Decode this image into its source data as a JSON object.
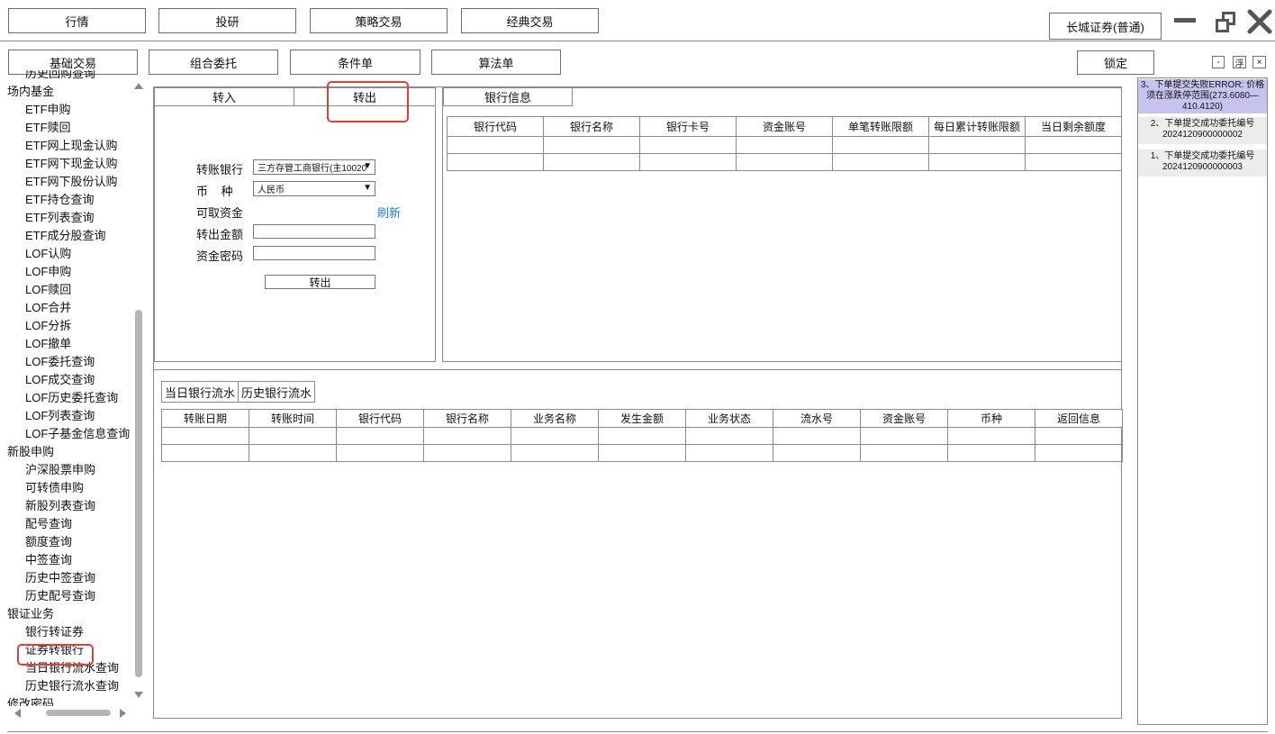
{
  "top_tabs": [
    "行情",
    "投研",
    "策略交易",
    "经典交易"
  ],
  "broker": "长城证券(普通)",
  "sub_tabs": [
    "基础交易",
    "组合委托",
    "条件单",
    "算法单"
  ],
  "lock_label": "锁定",
  "float_label": "浮",
  "close_label": "×",
  "minimize_label": "-",
  "tree": [
    {
      "t": "item",
      "label": "历史回购查询"
    },
    {
      "t": "grp",
      "label": "场内基金"
    },
    {
      "t": "item",
      "label": "ETF申购"
    },
    {
      "t": "item",
      "label": "ETF赎回"
    },
    {
      "t": "item",
      "label": "ETF网上现金认购"
    },
    {
      "t": "item",
      "label": "ETF网下现金认购"
    },
    {
      "t": "item",
      "label": "ETF网下股份认购"
    },
    {
      "t": "item",
      "label": "ETF持仓查询"
    },
    {
      "t": "item",
      "label": "ETF列表查询"
    },
    {
      "t": "item",
      "label": "ETF成分股查询"
    },
    {
      "t": "item",
      "label": "LOF认购"
    },
    {
      "t": "item",
      "label": "LOF申购"
    },
    {
      "t": "item",
      "label": "LOF赎回"
    },
    {
      "t": "item",
      "label": "LOF合并"
    },
    {
      "t": "item",
      "label": "LOF分拆"
    },
    {
      "t": "item",
      "label": "LOF撤单"
    },
    {
      "t": "item",
      "label": "LOF委托查询"
    },
    {
      "t": "item",
      "label": "LOF成交查询"
    },
    {
      "t": "item",
      "label": "LOF历史委托查询"
    },
    {
      "t": "item",
      "label": "LOF列表查询"
    },
    {
      "t": "item",
      "label": "LOF子基金信息查询"
    },
    {
      "t": "grp",
      "label": "新股申购"
    },
    {
      "t": "item",
      "label": "沪深股票申购"
    },
    {
      "t": "item",
      "label": "可转债申购"
    },
    {
      "t": "item",
      "label": "新股列表查询"
    },
    {
      "t": "item",
      "label": "配号查询"
    },
    {
      "t": "item",
      "label": "额度查询"
    },
    {
      "t": "item",
      "label": "中签查询"
    },
    {
      "t": "item",
      "label": "历史中签查询"
    },
    {
      "t": "item",
      "label": "历史配号查询"
    },
    {
      "t": "grp",
      "label": "银证业务"
    },
    {
      "t": "item",
      "label": "银行转证券"
    },
    {
      "t": "item",
      "label": "证券转银行"
    },
    {
      "t": "item",
      "label": "当日银行流水查询"
    },
    {
      "t": "item",
      "label": "历史银行流水查询"
    },
    {
      "t": "grp",
      "label": "修改密码"
    }
  ],
  "transfer": {
    "tab_in": "转入",
    "tab_out": "转出",
    "bank_label": "转账银行",
    "bank_value": "三方存管工商银行(主10020",
    "currency_label": "币    种",
    "currency_value": "人民币",
    "available_label": "可取资金",
    "refresh_label": "刷新",
    "amount_label": "转出金额",
    "password_label": "资金密码",
    "submit_label": "转出"
  },
  "bank_info": {
    "tab": "银行信息",
    "columns": [
      "银行代码",
      "银行名称",
      "银行卡号",
      "资金账号",
      "单笔转账限额",
      "每日累计转账限额",
      "当日剩余额度"
    ]
  },
  "flow": {
    "tab_today": "当日银行流水",
    "tab_history": "历史银行流水",
    "columns": [
      "转账日期",
      "转账时间",
      "银行代码",
      "银行名称",
      "业务名称",
      "发生金额",
      "业务状态",
      "流水号",
      "资金账号",
      "币种",
      "返回信息"
    ]
  },
  "messages": [
    {
      "text": "3、下单提交失败ERROR: 价格须在涨跌停范围(273.6080—410.4120)",
      "highlight": true
    },
    {
      "text": "2、下单提交成功委托编号 2024120900000002",
      "highlight": false
    },
    {
      "text": "1、下单提交成功委托编号 2024120900000003",
      "highlight": false
    }
  ],
  "colors": {
    "accent": "#1a7fd1",
    "highlight": "#c6c3ef",
    "marker": "#e0403a"
  }
}
